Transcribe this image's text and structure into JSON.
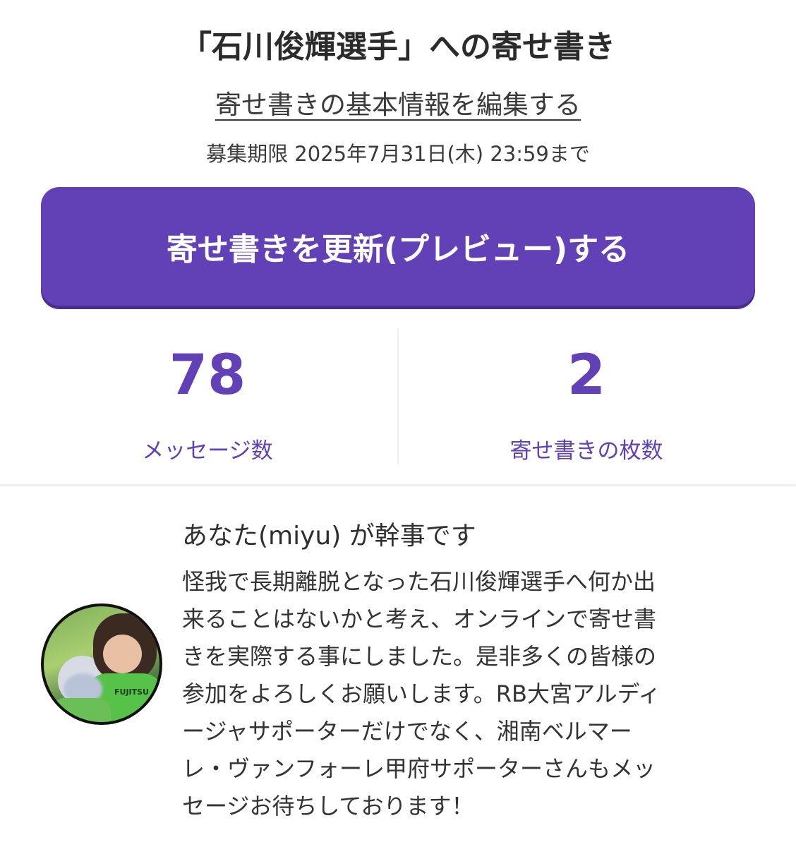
{
  "header": {
    "title": "「石川俊輝選手」への寄せ書き",
    "edit_link": "寄せ書きの基本情報を編集する",
    "deadline": "募集期限 2025年7月31日(木) 23:59まで"
  },
  "actions": {
    "update_button": "寄せ書きを更新(プレビュー)する"
  },
  "stats": {
    "messages": {
      "value": "78",
      "label": "メッセージ数"
    },
    "sheets": {
      "value": "2",
      "label": "寄せ書きの枚数"
    }
  },
  "organizer": {
    "title": "あなた(miyu) が幹事です",
    "avatar_shirt_text": "FUJITSU",
    "message_lines": [
      "怪我で長期離脱となった石川俊輝選手へ何か出",
      "来ることはないかと考え、オンラインで寄せ書",
      "きを実際する事にしました。是非多くの皆様の",
      "参加をよろしくお願いします。RB大宮アルディ",
      "ージャサポーターだけでなく、湘南ベルマー",
      "レ・ヴァンフォーレ甲府サポーターさんもメッ",
      "セージお待ちしております！"
    ]
  },
  "colors": {
    "accent": "#6240b5",
    "accent_shadow": "#4a2d90",
    "text": "#333333",
    "divider": "#f1eef9"
  }
}
